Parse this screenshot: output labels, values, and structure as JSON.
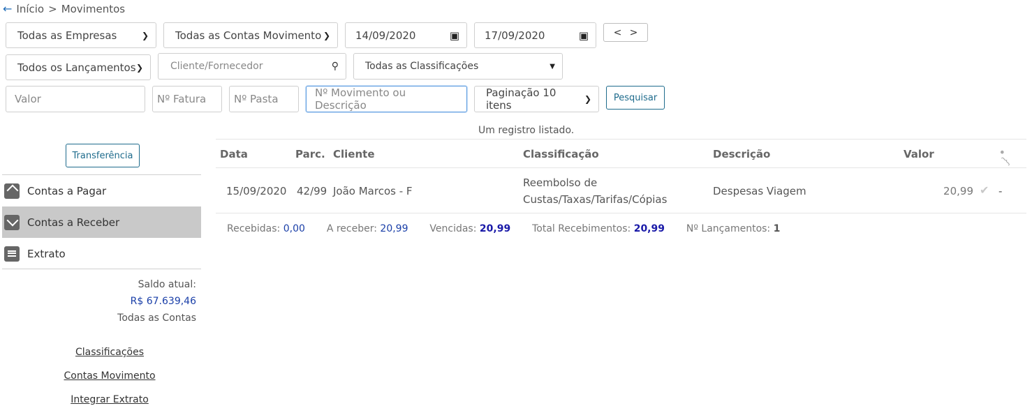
{
  "breadcrumb": {
    "home": "Início",
    "sep": ">",
    "current": "Movimentos"
  },
  "filters": {
    "empresas": "Todas as Empresas",
    "contas": "Todas as Contas Movimento",
    "date_from": "14/09/2020",
    "date_to": "17/09/2020",
    "prev": "<",
    "next": ">",
    "lancamentos": "Todos os Lançamentos",
    "cliente_placeholder": "Cliente/Fornecedor",
    "classificacoes": "Todas as Classificações",
    "valor_placeholder": "Valor",
    "fatura_placeholder": "Nº Fatura",
    "pasta_placeholder": "Nº Pasta",
    "movimento_placeholder": "Nº Movimento ou Descrição",
    "paginacao": "Paginação 10 itens",
    "search_label": "Pesquisar"
  },
  "status_text": "Um registro listado.",
  "sidebar": {
    "transfer_label": "Transferência",
    "items": [
      {
        "label": "Contas a Pagar",
        "icon": "upload-tray-icon",
        "active": false
      },
      {
        "label": "Contas a Receber",
        "icon": "download-tray-icon",
        "active": true
      },
      {
        "label": "Extrato",
        "icon": "statement-icon",
        "active": false
      }
    ],
    "saldo_label": "Saldo atual:",
    "saldo_value": "R$ 67.639,46",
    "saldo_scope": "Todas as Contas",
    "links": [
      "Classificações",
      "Contas Movimento",
      "Integrar Extrato"
    ]
  },
  "table": {
    "headers": {
      "data": "Data",
      "parc": "Parc.",
      "cliente": "Cliente",
      "classificacao": "Classificação",
      "descricao": "Descrição",
      "valor": "Valor"
    },
    "rows": [
      {
        "data": "15/09/2020",
        "parc": "42/99",
        "cliente": "João Marcos - F",
        "class_line1": "Reembolso de",
        "class_line2": "Custas/Taxas/Tarifas/Cópias",
        "descricao": "Despesas Viagem",
        "valor": "20,99",
        "extra": "-"
      }
    ]
  },
  "summary": {
    "recebidas_label": "Recebidas:",
    "recebidas_value": "0,00",
    "areceber_label": "A receber:",
    "areceber_value": "20,99",
    "vencidas_label": "Vencidas:",
    "vencidas_value": "20,99",
    "total_label": "Total Recebimentos:",
    "total_value": "20,99",
    "lanc_label": "Nº Lançamentos:",
    "lanc_value": "1"
  },
  "colors": {
    "accent": "#1e6bb8",
    "active_bg": "#c9c9c9",
    "value_blue": "#1a3fa8"
  }
}
